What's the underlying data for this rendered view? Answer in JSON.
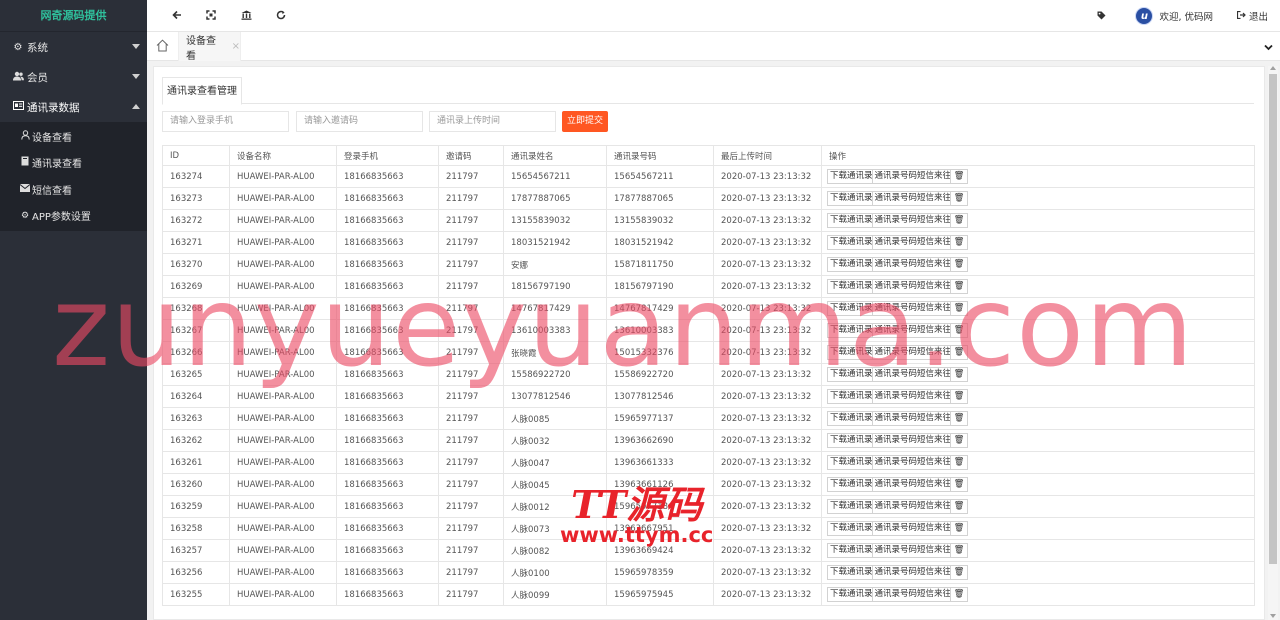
{
  "sidebar": {
    "logo": "网奇源码提供",
    "groups": [
      {
        "label": "系统",
        "icon": "gear-icon"
      },
      {
        "label": "会员",
        "icon": "users-icon"
      },
      {
        "label": "通讯录数据",
        "icon": "id-card-icon"
      }
    ],
    "subitems": [
      {
        "label": "设备查看",
        "icon": "user-icon"
      },
      {
        "label": "通讯录查看",
        "icon": "book-icon"
      },
      {
        "label": "短信查看",
        "icon": "envelope-icon"
      },
      {
        "label": "APP参数设置",
        "icon": "cog-icon"
      }
    ]
  },
  "header": {
    "welcome": "欢迎, 优码网",
    "logout": "退出",
    "avatar_letter": "u"
  },
  "tabs": {
    "active": "设备查看",
    "close": "×"
  },
  "panel": {
    "subtab": "通讯录查看管理",
    "filters": {
      "phone_placeholder": "请输入登录手机",
      "invite_placeholder": "请输入邀请码",
      "time_placeholder": "通讯录上传时间",
      "submit": "立即提交"
    }
  },
  "table": {
    "columns": [
      "ID",
      "设备名称",
      "登录手机",
      "邀请码",
      "通讯录姓名",
      "通讯录号码",
      "最后上传时间",
      "操作"
    ],
    "op_labels": {
      "download": "下载通讯录",
      "sms": "通讯录号码短信来往",
      "delete": "🗑"
    },
    "rows": [
      [
        "163274",
        "HUAWEI-PAR-AL00",
        "18166835663",
        "211797",
        "15654567211",
        "15654567211",
        "2020-07-13 23:13:32"
      ],
      [
        "163273",
        "HUAWEI-PAR-AL00",
        "18166835663",
        "211797",
        "17877887065",
        "17877887065",
        "2020-07-13 23:13:32"
      ],
      [
        "163272",
        "HUAWEI-PAR-AL00",
        "18166835663",
        "211797",
        "13155839032",
        "13155839032",
        "2020-07-13 23:13:32"
      ],
      [
        "163271",
        "HUAWEI-PAR-AL00",
        "18166835663",
        "211797",
        "18031521942",
        "18031521942",
        "2020-07-13 23:13:32"
      ],
      [
        "163270",
        "HUAWEI-PAR-AL00",
        "18166835663",
        "211797",
        "安娜",
        "15871811750",
        "2020-07-13 23:13:32"
      ],
      [
        "163269",
        "HUAWEI-PAR-AL00",
        "18166835663",
        "211797",
        "18156797190",
        "18156797190",
        "2020-07-13 23:13:32"
      ],
      [
        "163268",
        "HUAWEI-PAR-AL00",
        "18166835663",
        "211797",
        "14767817429",
        "14767817429",
        "2020-07-13 23:13:32"
      ],
      [
        "163267",
        "HUAWEI-PAR-AL00",
        "18166835663",
        "211797",
        "13610003383",
        "13610003383",
        "2020-07-13 23:13:32"
      ],
      [
        "163266",
        "HUAWEI-PAR-AL00",
        "18166835663",
        "211797",
        "张晓霞",
        "15015332376",
        "2020-07-13 23:13:32"
      ],
      [
        "163265",
        "HUAWEI-PAR-AL00",
        "18166835663",
        "211797",
        "15586922720",
        "15586922720",
        "2020-07-13 23:13:32"
      ],
      [
        "163264",
        "HUAWEI-PAR-AL00",
        "18166835663",
        "211797",
        "13077812546",
        "13077812546",
        "2020-07-13 23:13:32"
      ],
      [
        "163263",
        "HUAWEI-PAR-AL00",
        "18166835663",
        "211797",
        "人脉0085",
        "15965977137",
        "2020-07-13 23:13:32"
      ],
      [
        "163262",
        "HUAWEI-PAR-AL00",
        "18166835663",
        "211797",
        "人脉0032",
        "13963662690",
        "2020-07-13 23:13:32"
      ],
      [
        "163261",
        "HUAWEI-PAR-AL00",
        "18166835663",
        "211797",
        "人脉0047",
        "13963661333",
        "2020-07-13 23:13:32"
      ],
      [
        "163260",
        "HUAWEI-PAR-AL00",
        "18166835663",
        "211797",
        "人脉0045",
        "13963661126",
        "2020-07-13 23:13:32"
      ],
      [
        "163259",
        "HUAWEI-PAR-AL00",
        "18166835663",
        "211797",
        "人脉0012",
        "15965977184",
        "2020-07-13 23:13:32"
      ],
      [
        "163258",
        "HUAWEI-PAR-AL00",
        "18166835663",
        "211797",
        "人脉0073",
        "13963667951",
        "2020-07-13 23:13:32"
      ],
      [
        "163257",
        "HUAWEI-PAR-AL00",
        "18166835663",
        "211797",
        "人脉0082",
        "13963669424",
        "2020-07-13 23:13:32"
      ],
      [
        "163256",
        "HUAWEI-PAR-AL00",
        "18166835663",
        "211797",
        "人脉0100",
        "15965978359",
        "2020-07-13 23:13:32"
      ],
      [
        "163255",
        "HUAWEI-PAR-AL00",
        "18166835663",
        "211797",
        "人脉0099",
        "15965975945",
        "2020-07-13 23:13:32"
      ]
    ]
  },
  "watermark": {
    "text": "zunyueyuanma.com",
    "logo_top": "TT源码",
    "logo_url": "www.ttym.cc"
  },
  "colors": {
    "sidebar_bg": "#2b2f38",
    "logo_text": "#2fbf9b",
    "submit_bg": "#ff5722",
    "watermark": "#eb4b64",
    "logo_red": "#e8232b"
  }
}
